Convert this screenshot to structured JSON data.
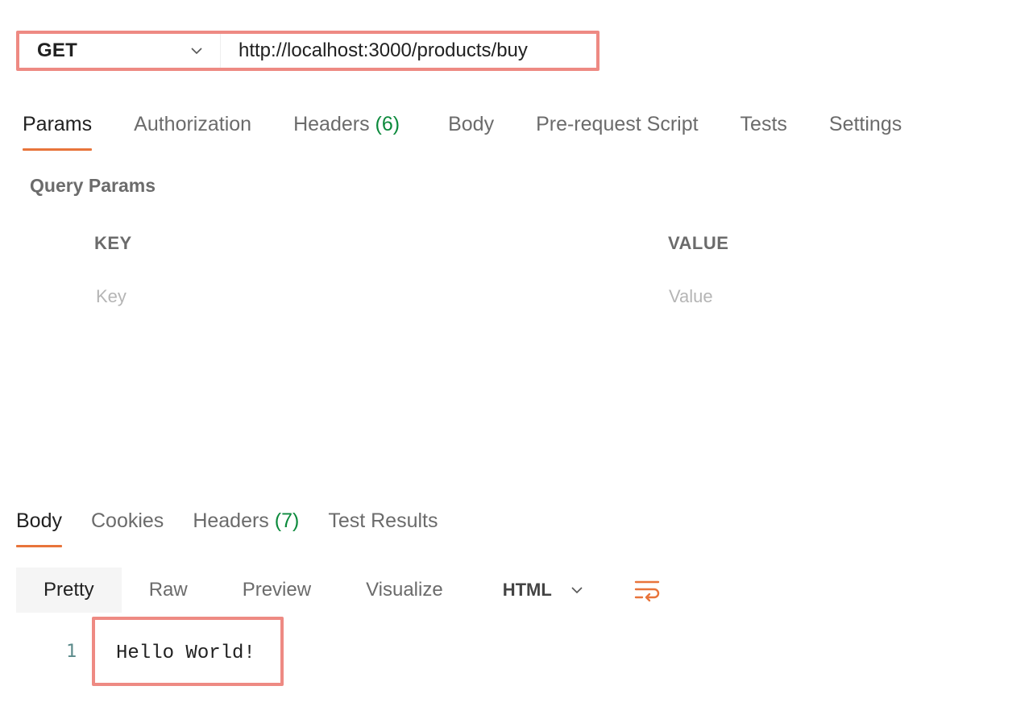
{
  "request": {
    "method": "GET",
    "url": "http://localhost:3000/products/buy"
  },
  "request_tabs": [
    {
      "label": "Params",
      "count": "",
      "active": true
    },
    {
      "label": "Authorization",
      "count": ""
    },
    {
      "label": "Headers",
      "count": "(6)"
    },
    {
      "label": "Body",
      "count": ""
    },
    {
      "label": "Pre-request Script",
      "count": ""
    },
    {
      "label": "Tests",
      "count": ""
    },
    {
      "label": "Settings",
      "count": ""
    }
  ],
  "params": {
    "title": "Query Params",
    "key_header": "KEY",
    "value_header": "VALUE",
    "key_placeholder": "Key",
    "value_placeholder": "Value"
  },
  "response_tabs": [
    {
      "label": "Body",
      "count": "",
      "active": true
    },
    {
      "label": "Cookies",
      "count": ""
    },
    {
      "label": "Headers",
      "count": "(7)"
    },
    {
      "label": "Test Results",
      "count": ""
    }
  ],
  "body_view": {
    "modes": [
      "Pretty",
      "Raw",
      "Preview",
      "Visualize"
    ],
    "active_mode": "Pretty",
    "format": "HTML"
  },
  "response_body": {
    "line_number": "1",
    "text": "Hello World!"
  },
  "colors": {
    "accent": "#e8743b",
    "highlight_border": "#ee8a83",
    "count_green": "#0c8a3c"
  }
}
